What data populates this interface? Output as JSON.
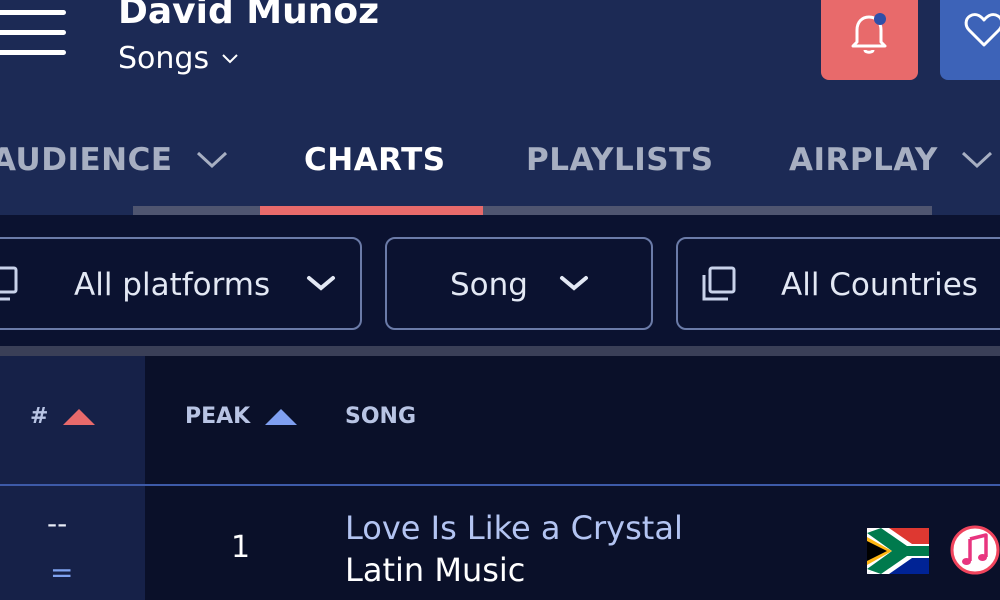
{
  "header": {
    "artist_name": "David Munoz",
    "section_label": "Songs",
    "icons": {
      "menu": "menu-icon",
      "bell": "bell-icon",
      "heart": "heart-icon"
    },
    "colors": {
      "bell_button": "#e86a6b",
      "heart_button": "#3d63b8",
      "header_bg": "#1c2a55"
    }
  },
  "tabs": [
    {
      "label": "AUDIENCE",
      "active": false,
      "has_dropdown": true
    },
    {
      "label": "CHARTS",
      "active": true,
      "has_dropdown": false
    },
    {
      "label": "PLAYLISTS",
      "active": false,
      "has_dropdown": false
    },
    {
      "label": "AIRPLAY",
      "active": false,
      "has_dropdown": true
    }
  ],
  "filters": {
    "platforms": {
      "value": "All platforms",
      "icon": "copy-icon"
    },
    "type": {
      "value": "Song"
    },
    "countries": {
      "value": "All Countries",
      "icon": "copy-icon"
    }
  },
  "table": {
    "columns": {
      "rank": "#",
      "peak": "PEAK",
      "song": "SONG"
    },
    "sort_colors": {
      "rank": "#e86a6b",
      "peak": "#7f9ff0"
    },
    "rows": [
      {
        "rank": "--",
        "change": "=",
        "peak": "1",
        "title": "Love Is Like a Crystal",
        "genre": "Latin Music",
        "country_flag": "south-africa-flag",
        "platform_icon": "apple-music-icon"
      }
    ]
  }
}
